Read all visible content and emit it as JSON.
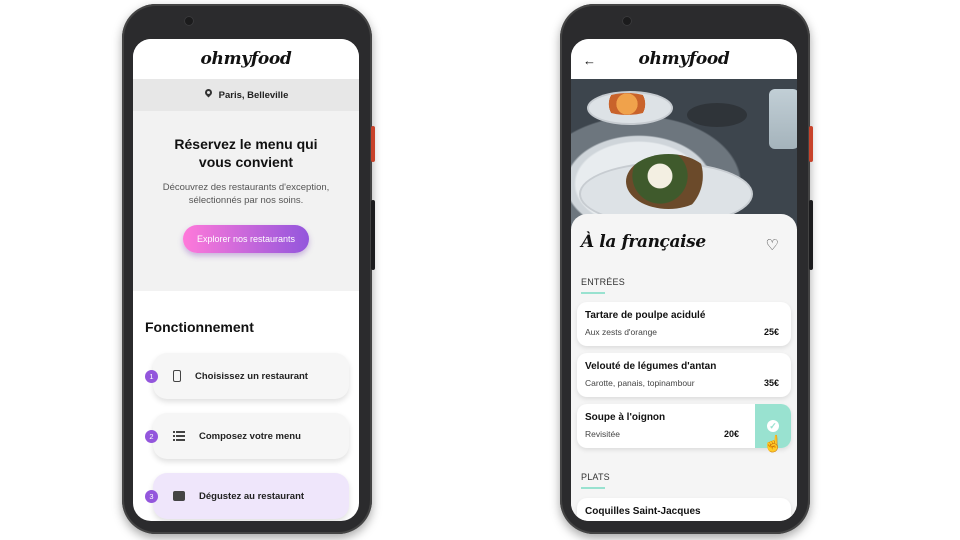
{
  "left": {
    "logo": "ohmyfood",
    "location": "Paris, Belleville",
    "hero_title": "Réservez le menu qui vous convient",
    "hero_subtitle": "Découvrez des restaurants d'exception, sélectionnés par nos soins.",
    "cta_label": "Explorer nos restaurants",
    "how_title": "Fonctionnement",
    "steps": [
      {
        "num": "1",
        "label": "Choisissez un restaurant",
        "icon": "phone-icon"
      },
      {
        "num": "2",
        "label": "Composez votre menu",
        "icon": "list-icon"
      },
      {
        "num": "3",
        "label": "Dégustez au restaurant",
        "icon": "storefront-icon"
      }
    ]
  },
  "right": {
    "logo": "ohmyfood",
    "back_icon": "arrow-left-icon",
    "restaurant_title": "À la française",
    "favorite_icon": "heart-icon",
    "sections": [
      {
        "title": "ENTRÉES",
        "dishes": [
          {
            "name": "Tartare de poulpe acidulé",
            "description": "Aux zests d'orange",
            "price": "25€",
            "selected": false
          },
          {
            "name": "Velouté de légumes d'antan",
            "description": "Carotte, panais, topinambour",
            "price": "35€",
            "selected": false
          },
          {
            "name": "Soupe à l'oignon",
            "description": "Revisitée",
            "price": "20€",
            "selected": true
          }
        ]
      },
      {
        "title": "PLATS",
        "dishes": [
          {
            "name": "Coquilles Saint-Jacques",
            "description": "",
            "price": "",
            "selected": false
          }
        ]
      }
    ]
  },
  "colors": {
    "accent_pink": "#ff79da",
    "accent_purple": "#9356dc",
    "accent_mint": "#99e2d0"
  }
}
